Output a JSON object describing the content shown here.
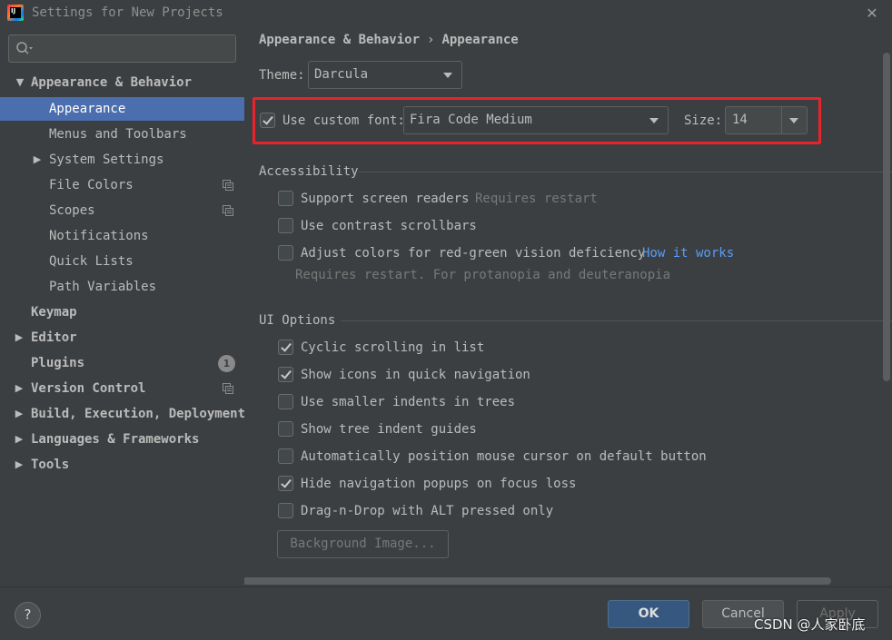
{
  "window": {
    "title": "Settings for New Projects",
    "logo_text": "IJ"
  },
  "search": {
    "placeholder": ""
  },
  "sidebar": {
    "items": [
      {
        "label": "Appearance & Behavior",
        "expanded": true
      },
      {
        "label": "Appearance",
        "selected": true
      },
      {
        "label": "Menus and Toolbars"
      },
      {
        "label": "System Settings",
        "collapsed": true
      },
      {
        "label": "File Colors"
      },
      {
        "label": "Scopes"
      },
      {
        "label": "Notifications"
      },
      {
        "label": "Quick Lists"
      },
      {
        "label": "Path Variables"
      },
      {
        "label": "Keymap"
      },
      {
        "label": "Editor",
        "collapsed": true
      },
      {
        "label": "Plugins",
        "badge": "1"
      },
      {
        "label": "Version Control",
        "collapsed": true
      },
      {
        "label": "Build, Execution, Deployment",
        "collapsed": true
      },
      {
        "label": "Languages & Frameworks",
        "collapsed": true
      },
      {
        "label": "Tools",
        "collapsed": true
      }
    ]
  },
  "breadcrumb": {
    "parent": "Appearance & Behavior",
    "separator": "›",
    "current": "Appearance"
  },
  "theme": {
    "label": "Theme:",
    "value": "Darcula"
  },
  "custom_font": {
    "checked": true,
    "label": "Use custom font:",
    "font_value": "Fira Code Medium",
    "size_label": "Size:",
    "size_value": "14"
  },
  "accessibility": {
    "title": "Accessibility",
    "screen_readers": {
      "label": "Support screen readers",
      "hint": "Requires restart",
      "checked": false
    },
    "contrast_scrollbars": {
      "label": "Use contrast scrollbars",
      "checked": false
    },
    "red_green": {
      "label": "Adjust colors for red-green vision deficiency",
      "link": "How it works",
      "hint": "Requires restart. For protanopia and deuteranopia",
      "checked": false
    }
  },
  "ui_options": {
    "title": "UI Options",
    "options": [
      {
        "label": "Cyclic scrolling in list",
        "checked": true
      },
      {
        "label": "Show icons in quick navigation",
        "checked": true
      },
      {
        "label": "Use smaller indents in trees",
        "checked": false
      },
      {
        "label": "Show tree indent guides",
        "checked": false
      },
      {
        "label": "Automatically position mouse cursor on default button",
        "checked": false
      },
      {
        "label": "Hide navigation popups on focus loss",
        "checked": true
      },
      {
        "label": "Drag-n-Drop with ALT pressed only",
        "checked": false
      }
    ],
    "background_image_button": "Background Image..."
  },
  "footer": {
    "help": "?",
    "ok": "OK",
    "cancel": "Cancel",
    "apply": "Apply"
  },
  "watermark": "CSDN @人家卧底",
  "colors": {
    "background": "#3c3f41",
    "selection": "#4b6eaf",
    "highlight_frame": "#e8232b",
    "link": "#589df6",
    "ok_button": "#365880"
  }
}
